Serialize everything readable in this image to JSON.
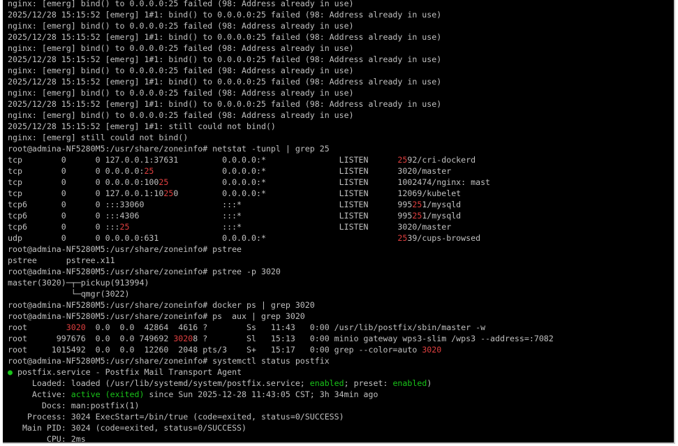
{
  "colors": {
    "background": "#000000",
    "text": "#c0c0c0",
    "highlight_red": "#e04040",
    "status_green": "#19c419"
  },
  "terminal": {
    "lines": [
      [
        {
          "t": "nginx: [emerg] bind() to 0.0.0.0:25 failed (98: Address already in use)",
          "c": "default"
        }
      ],
      [
        {
          "t": "2025/12/28 15:15:52 [emerg] 1#1: bind() to 0.0.0.0:25 failed (98: Address already in use)",
          "c": "default"
        }
      ],
      [
        {
          "t": "nginx: [emerg] bind() to 0.0.0.0:25 failed (98: Address already in use)",
          "c": "default"
        }
      ],
      [
        {
          "t": "2025/12/28 15:15:52 [emerg] 1#1: bind() to 0.0.0.0:25 failed (98: Address already in use)",
          "c": "default"
        }
      ],
      [
        {
          "t": "nginx: [emerg] bind() to 0.0.0.0:25 failed (98: Address already in use)",
          "c": "default"
        }
      ],
      [
        {
          "t": "2025/12/28 15:15:52 [emerg] 1#1: bind() to 0.0.0.0:25 failed (98: Address already in use)",
          "c": "default"
        }
      ],
      [
        {
          "t": "nginx: [emerg] bind() to 0.0.0.0:25 failed (98: Address already in use)",
          "c": "default"
        }
      ],
      [
        {
          "t": "2025/12/28 15:15:52 [emerg] 1#1: bind() to 0.0.0.0:25 failed (98: Address already in use)",
          "c": "default"
        }
      ],
      [
        {
          "t": "nginx: [emerg] bind() to 0.0.0.0:25 failed (98: Address already in use)",
          "c": "default"
        }
      ],
      [
        {
          "t": "2025/12/28 15:15:52 [emerg] 1#1: bind() to 0.0.0.0:25 failed (98: Address already in use)",
          "c": "default"
        }
      ],
      [
        {
          "t": "nginx: [emerg] bind() to 0.0.0.0:25 failed (98: Address already in use)",
          "c": "default"
        }
      ],
      [
        {
          "t": "2025/12/28 15:15:52 [emerg] 1#1: still could not bind()",
          "c": "default"
        }
      ],
      [
        {
          "t": "nginx: [emerg] still could not bind()",
          "c": "default"
        }
      ],
      [
        {
          "t": "root@admina-NF5280M5:/usr/share/zoneinfo# netstat -tunpl | grep 25",
          "c": "default"
        }
      ],
      [
        {
          "t": "tcp        0      0 127.0.0.1:37631         0.0.0.0:*               LISTEN      ",
          "c": "default"
        },
        {
          "t": "25",
          "c": "red"
        },
        {
          "t": "92/cri-dockerd",
          "c": "default"
        }
      ],
      [
        {
          "t": "tcp        0      0 0.0.0.0:",
          "c": "default"
        },
        {
          "t": "25",
          "c": "red"
        },
        {
          "t": "              0.0.0.0:*               LISTEN      3020/master",
          "c": "default"
        }
      ],
      [
        {
          "t": "tcp        0      0 0.0.0.0:100",
          "c": "default"
        },
        {
          "t": "25",
          "c": "red"
        },
        {
          "t": "           0.0.0.0:*               LISTEN      1002474/nginx: mast",
          "c": "default"
        }
      ],
      [
        {
          "t": "tcp        0      0 127.0.0.1:10",
          "c": "default"
        },
        {
          "t": "25",
          "c": "red"
        },
        {
          "t": "0         0.0.0.0:*               LISTEN      12069/kubelet",
          "c": "default"
        }
      ],
      [
        {
          "t": "tcp6       0      0 :::33060                :::*                    LISTEN      995",
          "c": "default"
        },
        {
          "t": "25",
          "c": "red"
        },
        {
          "t": "1/mysqld",
          "c": "default"
        }
      ],
      [
        {
          "t": "tcp6       0      0 :::4306                 :::*                    LISTEN      995",
          "c": "default"
        },
        {
          "t": "25",
          "c": "red"
        },
        {
          "t": "1/mysqld",
          "c": "default"
        }
      ],
      [
        {
          "t": "tcp6       0      0 :::",
          "c": "default"
        },
        {
          "t": "25",
          "c": "red"
        },
        {
          "t": "                   :::*                    LISTEN      3020/master",
          "c": "default"
        }
      ],
      [
        {
          "t": "udp        0      0 0.0.0.0:631             0.0.0.0:*                           ",
          "c": "default"
        },
        {
          "t": "25",
          "c": "red"
        },
        {
          "t": "39/cups-browsed",
          "c": "default"
        }
      ],
      [
        {
          "t": "root@admina-NF5280M5:/usr/share/zoneinfo# pstree",
          "c": "default"
        }
      ],
      [
        {
          "t": "pstree      pstree.x11",
          "c": "default"
        }
      ],
      [
        {
          "t": "root@admina-NF5280M5:/usr/share/zoneinfo# pstree -p 3020",
          "c": "default"
        }
      ],
      [
        {
          "t": "master(3020)─┬─pickup(913994)",
          "c": "default"
        }
      ],
      [
        {
          "t": "             └─qmgr(3022)",
          "c": "default"
        }
      ],
      [
        {
          "t": "root@admina-NF5280M5:/usr/share/zoneinfo# docker ps | grep 3020",
          "c": "default"
        }
      ],
      [
        {
          "t": "root@admina-NF5280M5:/usr/share/zoneinfo# ps  aux | grep 3020",
          "c": "default"
        }
      ],
      [
        {
          "t": "root        ",
          "c": "default"
        },
        {
          "t": "3020",
          "c": "red"
        },
        {
          "t": "  0.0  0.0  42864  4616 ?        Ss   11:43   0:00 /usr/lib/postfix/sbin/master -w",
          "c": "default"
        }
      ],
      [
        {
          "t": "root      997676  0.0  0.0 749692 ",
          "c": "default"
        },
        {
          "t": "3020",
          "c": "red"
        },
        {
          "t": "8 ?        Sl   15:13   0:00 minio gateway wps3-slim /wps3 --address=:7082",
          "c": "default"
        }
      ],
      [
        {
          "t": "root     1015492  0.0  0.0  12260  2048 pts/3    S+   15:17   0:00 grep --color=auto ",
          "c": "default"
        },
        {
          "t": "3020",
          "c": "red"
        }
      ],
      [
        {
          "t": "root@admina-NF5280M5:/usr/share/zoneinfo# systemctl status postfix",
          "c": "default"
        }
      ],
      [
        {
          "t": "●",
          "c": "green"
        },
        {
          "t": " postfix.service - Postfix Mail Transport Agent",
          "c": "default"
        }
      ],
      [
        {
          "t": "     Loaded: loaded (/usr/lib/systemd/system/postfix.service; ",
          "c": "default"
        },
        {
          "t": "enabled",
          "c": "green"
        },
        {
          "t": "; preset: ",
          "c": "default"
        },
        {
          "t": "enabled",
          "c": "green"
        },
        {
          "t": ")",
          "c": "default"
        }
      ],
      [
        {
          "t": "     Active: ",
          "c": "default"
        },
        {
          "t": "active (exited)",
          "c": "green"
        },
        {
          "t": " since Sun 2025-12-28 11:43:05 CST; 3h 34min ago",
          "c": "default"
        }
      ],
      [
        {
          "t": "       Docs: man:postfix(1)",
          "c": "default"
        }
      ],
      [
        {
          "t": "    Process: 3024 ExecStart=/bin/true (code=exited, status=0/SUCCESS)",
          "c": "default"
        }
      ],
      [
        {
          "t": "   Main PID: 3024 (code=exited, status=0/SUCCESS)",
          "c": "default"
        }
      ],
      [
        {
          "t": "        CPU: 2ms",
          "c": "default"
        }
      ]
    ]
  }
}
